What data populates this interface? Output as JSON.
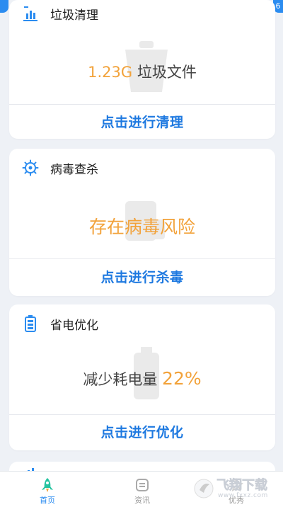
{
  "status": {
    "badge": "6"
  },
  "cards": [
    {
      "title": "垃圾清理",
      "stat_value": "1.23G",
      "stat_text": "垃圾文件",
      "action": "点击进行清理"
    },
    {
      "title": "病毒查杀",
      "stat_text": "存在病毒风险",
      "action": "点击进行杀毒"
    },
    {
      "title": "省电优化",
      "stat_text": "减少耗电量",
      "stat_value": "22%",
      "action": "点击进行优化"
    }
  ],
  "tabbar": {
    "tabs": [
      {
        "label": "首页",
        "icon": "rocket-icon",
        "active": true
      },
      {
        "label": "资讯",
        "icon": "news-icon",
        "active": false
      },
      {
        "label": "优秀",
        "icon": "star-icon",
        "active": false
      }
    ]
  },
  "watermark": {
    "text": "飞翔下载",
    "sub": "www.fxxz.com"
  },
  "colors": {
    "accent": "#1e79e0",
    "orange": "#f2a23a",
    "tab_active": "#2b8cf0",
    "background": "#eef1f6"
  }
}
